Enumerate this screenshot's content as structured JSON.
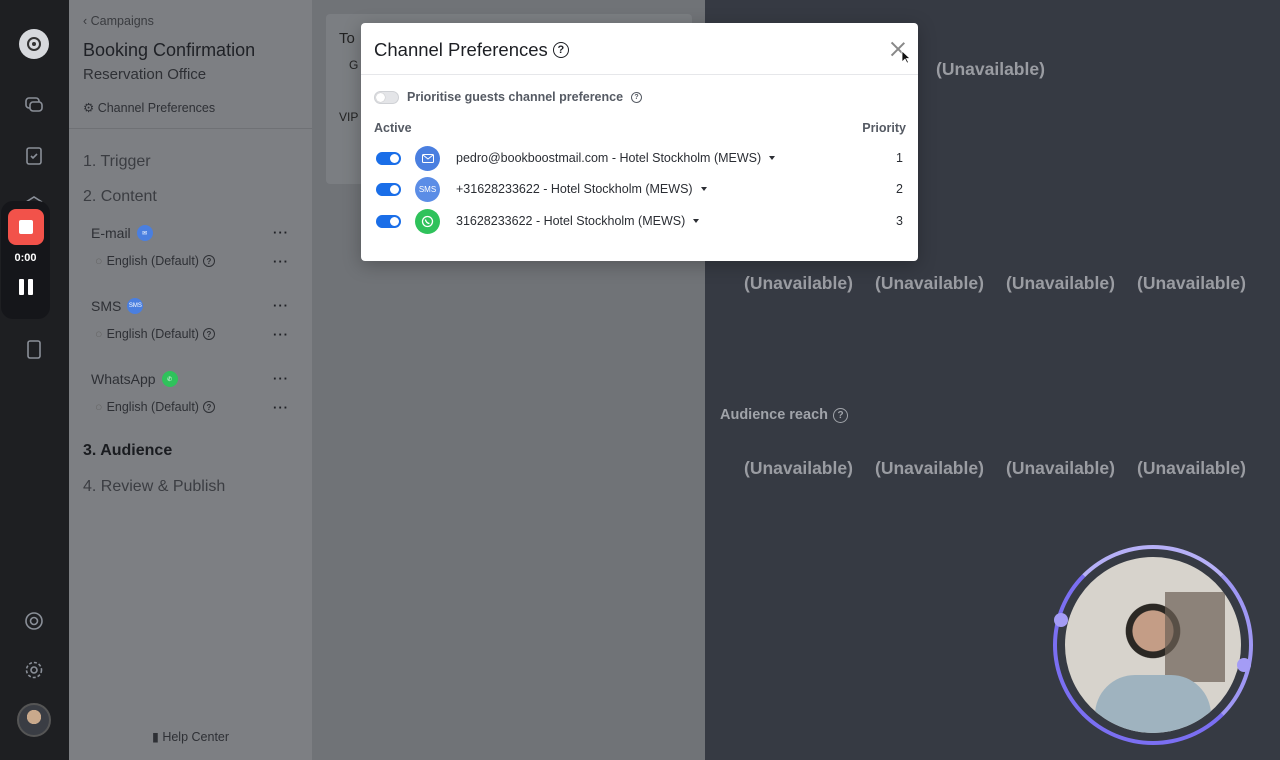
{
  "sidebar": {
    "back_label": "Campaigns",
    "title": "Booking Confirmation",
    "subtitle": "Reservation Office",
    "channel_prefs_link": "Channel Preferences",
    "steps": [
      "1. Trigger",
      "2. Content",
      "3. Audience",
      "4. Review & Publish"
    ],
    "channels": [
      {
        "name": "E-mail",
        "lang": "English (Default)",
        "badge_color": "#4a7fe0"
      },
      {
        "name": "SMS",
        "lang": "English (Default)",
        "badge_color": "#4a7fe0",
        "badge_text": "SMS"
      },
      {
        "name": "WhatsApp",
        "lang": "English (Default)",
        "badge_color": "#2fc25b"
      }
    ],
    "menu_dots": "···",
    "help_center": "Help Center"
  },
  "recorder": {
    "time": "0:00"
  },
  "middle": {
    "to_label": "To",
    "first_line": "G",
    "vip_label": "VIP"
  },
  "right": {
    "unavailable": "(Unavailable)",
    "audience_reach": "Audience reach"
  },
  "modal": {
    "title": "Channel Preferences",
    "prioritise_label": "Prioritise guests channel preference",
    "prioritise_enabled": false,
    "col_active": "Active",
    "col_priority": "Priority",
    "rows": [
      {
        "icon": "email-icon",
        "color": "#4a7fe0",
        "label": "pedro@bookboostmail.com - Hotel Stockholm (MEWS)",
        "priority": "1",
        "active": true
      },
      {
        "icon": "sms-icon",
        "color": "#5b8de6",
        "icon_text": "SMS",
        "label": "+31628233622 - Hotel Stockholm (MEWS)",
        "priority": "2",
        "active": true
      },
      {
        "icon": "whatsapp-icon",
        "color": "#2fc25b",
        "label": "31628233622 - Hotel Stockholm (MEWS)",
        "priority": "3",
        "active": true
      }
    ]
  },
  "colors": {
    "accent": "#1a6ee8",
    "recorder_stop": "#f2524a",
    "cam_ring": "#7b6ff2"
  }
}
